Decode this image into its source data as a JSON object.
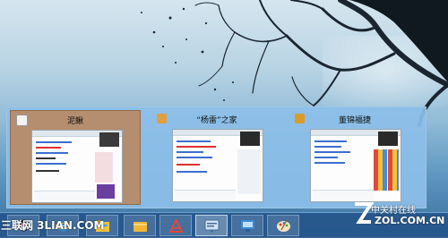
{
  "switcher": {
    "thumbnails": [
      {
        "title": "泥鳅",
        "active": true,
        "icon_color": "#f0f0f0"
      },
      {
        "title": "“杨雷”之家",
        "active": false,
        "icon_color": "#e0a040"
      },
      {
        "title": "董锦福捷",
        "active": false,
        "icon_color": "#d89c2a"
      }
    ]
  },
  "taskbar": {
    "items": [
      {
        "icon": "qq-penguin-icon"
      },
      {
        "icon": "internet-explorer-icon"
      },
      {
        "icon": "file-explorer-icon"
      },
      {
        "icon": "app-store-icon"
      },
      {
        "icon": "qq-chat-icon",
        "active": true
      },
      {
        "icon": "network-icon"
      },
      {
        "icon": "paint-palette-icon"
      }
    ]
  },
  "watermarks": {
    "left": "三联网 3LIAN.COM",
    "right_cn": "中关村在线",
    "right_url": "ZOL.COM.CN"
  },
  "colors": {
    "accent": "#24548a",
    "active_thumb": "#b48e6e",
    "panel": "#8cbee8"
  }
}
